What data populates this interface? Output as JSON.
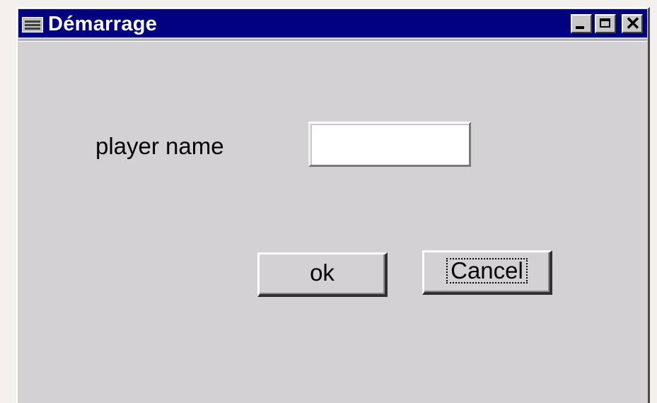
{
  "window": {
    "title": "Démarrage",
    "title_icon": "window-menu-icon",
    "controls": {
      "minimize_icon": "minimize-icon",
      "maximize_icon": "maximize-icon",
      "close_icon": "close-icon",
      "close_glyph": "✕"
    },
    "colors": {
      "titlebar": "#000080",
      "client": "#d3d1d3"
    }
  },
  "form": {
    "player_label": "player name",
    "player_value": "",
    "ok_label": "ok",
    "cancel_label": "Cancel"
  }
}
